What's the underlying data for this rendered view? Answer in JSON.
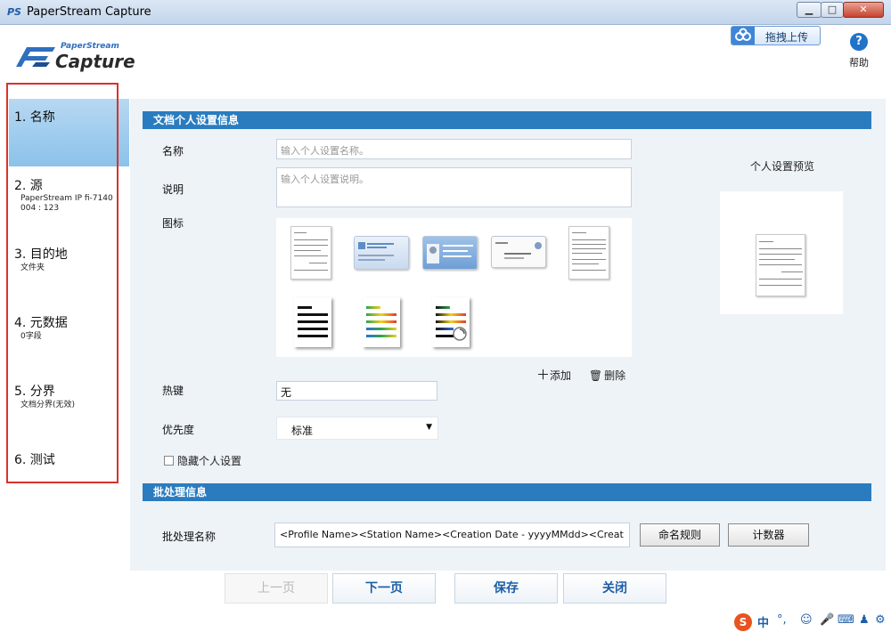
{
  "window": {
    "title": "PaperStream Capture",
    "min": "▁",
    "max": "□",
    "close": "✕"
  },
  "header": {
    "logo_small": "PaperStream",
    "logo_big": "Capture",
    "upload_label": "拖拽上传",
    "help_label": "帮助"
  },
  "sidebar": {
    "steps": [
      {
        "label": "1. 名称",
        "sub": ""
      },
      {
        "label": "2. 源",
        "sub": "PaperStream IP fi-7140\n004 : 123"
      },
      {
        "label": "3. 目的地",
        "sub": "文件夹"
      },
      {
        "label": "4. 元数据",
        "sub": "0字段"
      },
      {
        "label": "5. 分界",
        "sub": "文档分界(无效)"
      },
      {
        "label": "6. 测试",
        "sub": ""
      }
    ]
  },
  "profile": {
    "section_title": "文档个人设置信息",
    "name_label": "名称",
    "name_placeholder": "输入个人设置名称。",
    "desc_label": "说明",
    "desc_placeholder": "输入个人设置说明。",
    "icon_label": "图标",
    "add_label": "添加",
    "delete_label": "删除",
    "hotkey_label": "热键",
    "hotkey_value": "无",
    "priority_label": "优先度",
    "priority_value": "标准",
    "hide_label": "隐藏个人设置",
    "preview_title": "个人设置预览"
  },
  "batch": {
    "section_title": "批处理信息",
    "name_label": "批处理名称",
    "name_value": "<Profile Name><Station Name><Creation Date - yyyyMMdd><Creat",
    "naming_rule_label": "命名规则",
    "counter_label": "计数器"
  },
  "footer": {
    "prev_label": "上一页",
    "next_label": "下一页",
    "save_label": "保存",
    "close_label": "关闭"
  },
  "ime": {
    "lang": "中",
    "punct": "°,"
  },
  "colors": {
    "accent": "#2a7cbf",
    "sidebar_active": "#8bc2ea",
    "highlight_box": "#d9322a"
  }
}
